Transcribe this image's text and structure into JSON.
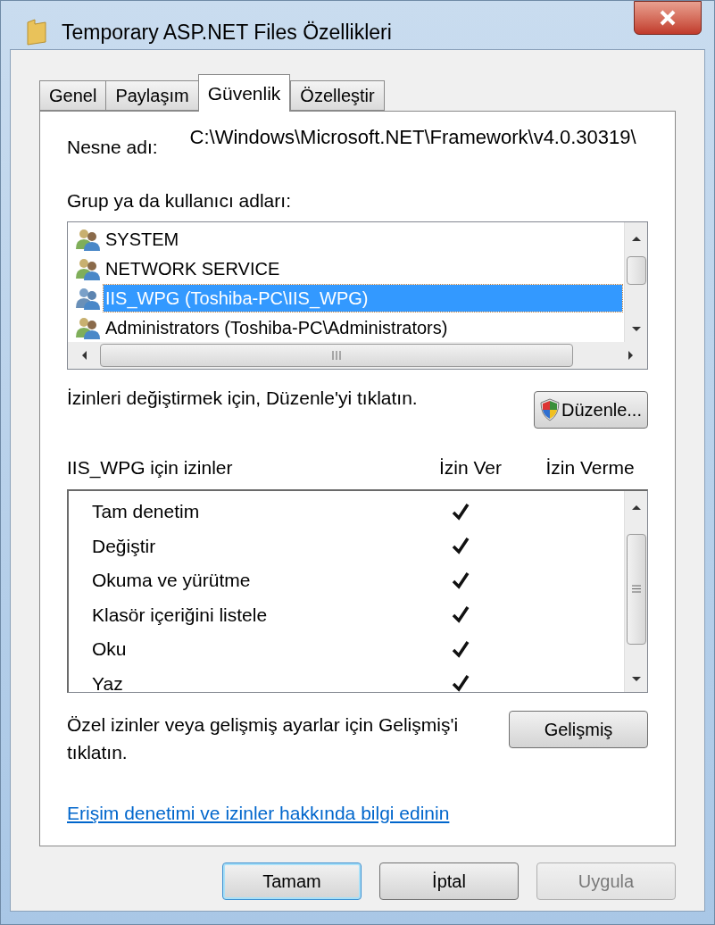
{
  "window": {
    "title": "Temporary ASP.NET Files Özellikleri"
  },
  "tabs": [
    {
      "label": "Genel",
      "selected": false
    },
    {
      "label": "Paylaşım",
      "selected": false
    },
    {
      "label": "Güvenlik",
      "selected": true
    },
    {
      "label": "Özelleştir",
      "selected": false
    }
  ],
  "object_name": {
    "label": "Nesne adı:",
    "value": "C:\\Windows\\Microsoft.NET\\Framework\\v4.0.30319\\"
  },
  "groups": {
    "label": "Grup ya da kullanıcı adları:",
    "items": [
      {
        "name": "SYSTEM",
        "selected": false
      },
      {
        "name": "NETWORK SERVICE",
        "selected": false
      },
      {
        "name": "IIS_WPG (Toshiba-PC\\IIS_WPG)",
        "selected": true
      },
      {
        "name": "Administrators (Toshiba-PC\\Administrators)",
        "selected": false
      }
    ]
  },
  "edit_hint": "İzinleri değiştirmek için, Düzenle'yi tıklatın.",
  "edit_button": "Düzenle...",
  "permissions": {
    "label": "IIS_WPG için izinler",
    "allow_header": "İzin Ver",
    "deny_header": "İzin Verme",
    "rows": [
      {
        "name": "Tam denetim",
        "allow": true,
        "deny": false
      },
      {
        "name": "Değiştir",
        "allow": true,
        "deny": false
      },
      {
        "name": "Okuma ve yürütme",
        "allow": true,
        "deny": false
      },
      {
        "name": "Klasör içeriğini listele",
        "allow": true,
        "deny": false
      },
      {
        "name": "Oku",
        "allow": true,
        "deny": false
      },
      {
        "name": "Yaz",
        "allow": true,
        "deny": false
      }
    ]
  },
  "advanced_hint": "Özel izinler veya gelişmiş ayarlar için Gelişmiş'i tıklatın.",
  "advanced_button": "Gelişmiş",
  "help_link": "Erişim denetimi ve izinler hakkında bilgi edinin",
  "buttons": [
    {
      "label": "Tamam",
      "kind": "default",
      "disabled": false
    },
    {
      "label": "İptal",
      "kind": "normal",
      "disabled": false
    },
    {
      "label": "Uygula",
      "kind": "normal",
      "disabled": true
    }
  ]
}
